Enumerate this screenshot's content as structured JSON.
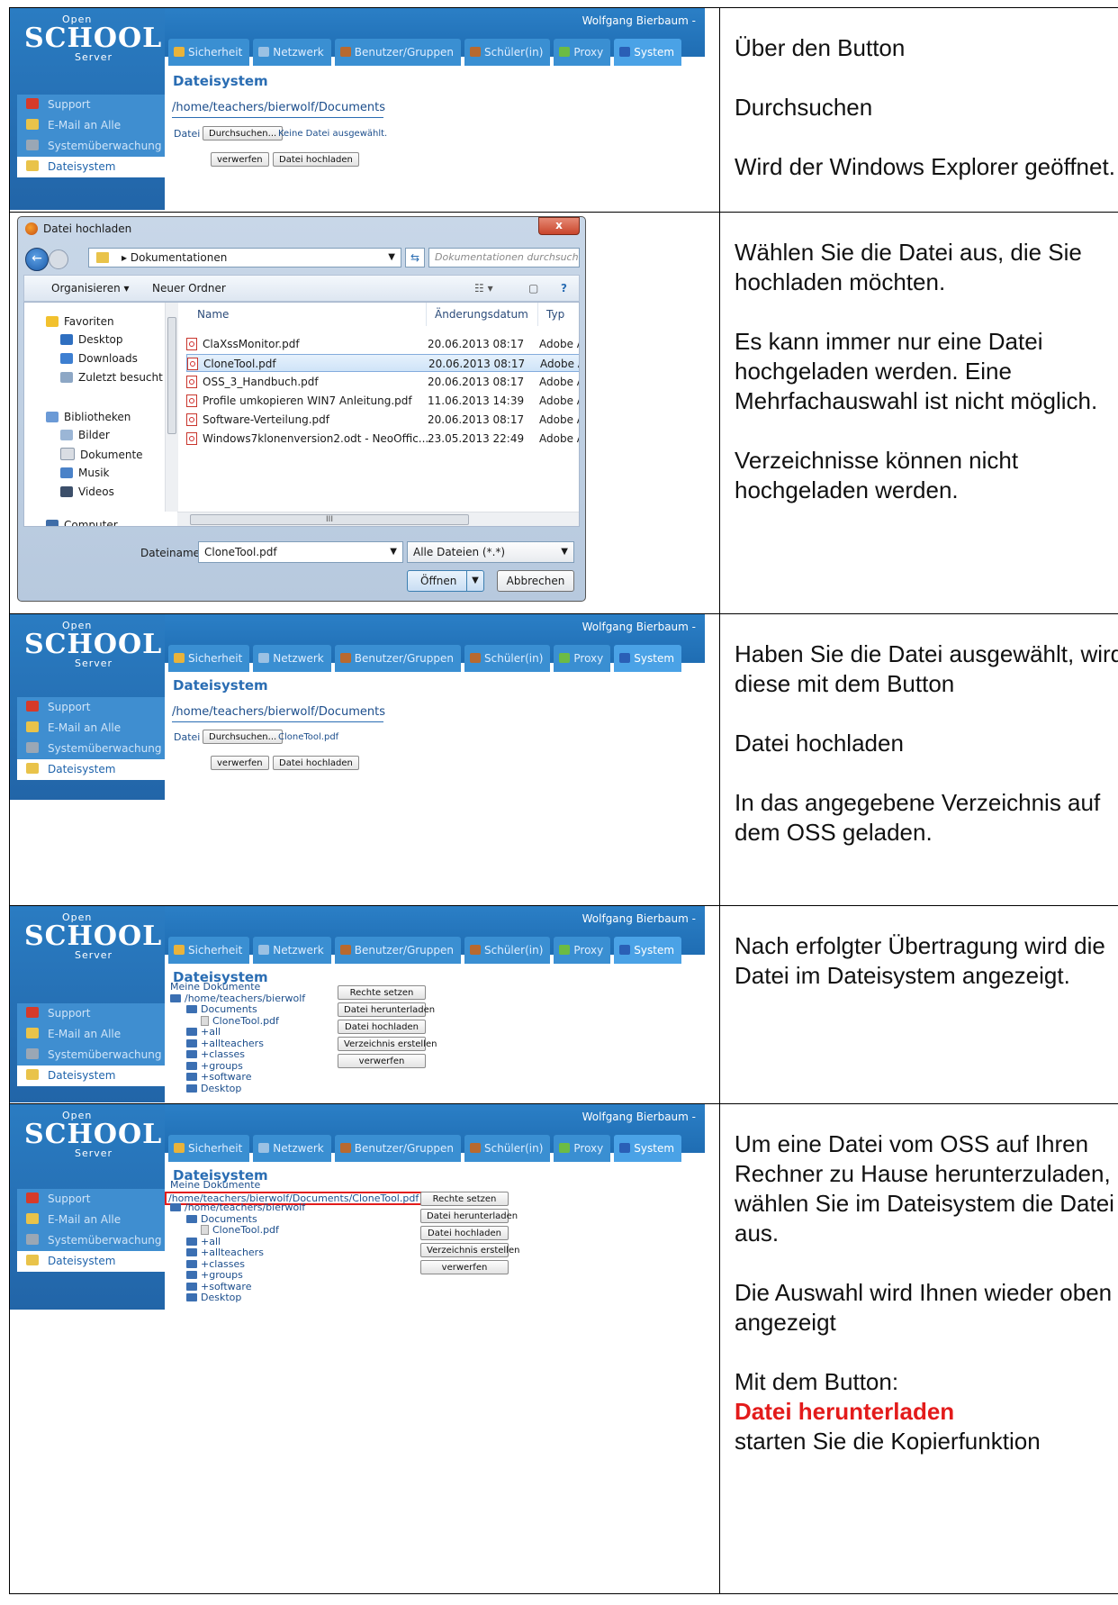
{
  "oss": {
    "logo_open": "Open",
    "logo_school": "SCHOOL",
    "logo_server": "Server",
    "user": "Wolfgang Bierbaum -",
    "tabs": [
      "Sicherheit",
      "Netzwerk",
      "Benutzer/Gruppen",
      "Schüler(in)",
      "Proxy",
      "System"
    ],
    "nav": [
      "Support",
      "E-Mail an Alle",
      "Systemüberwachung",
      "Dateisystem"
    ],
    "heading": "Dateisystem",
    "path": "/home/teachers/bierwolf/Documents",
    "datei_label": "Datei",
    "browse_button": "Durchsuchen...",
    "no_file": "Keine Datei ausgewählt.",
    "selected_file": "CloneTool.pdf",
    "discard_button": "verwerfen",
    "upload_button": "Datei hochladen",
    "meine_dokumente": "Meine Dokumente",
    "tree": [
      "/home/teachers/bierwolf",
      "Documents",
      "CloneTool.pdf",
      "+all",
      "+allteachers",
      "+classes",
      "+groups",
      "+software",
      "Desktop"
    ],
    "selected_path": "/home/teachers/bierwolf/Documents/CloneTool.pdf",
    "fs_buttons": [
      "Rechte setzen",
      "Datei herunterladen",
      "Datei hochladen",
      "Verzeichnis erstellen",
      "verwerfen"
    ]
  },
  "dialog": {
    "title": "Datei hochladen",
    "address": "Dokumentationen",
    "search_placeholder": "Dokumentationen durchsuchen",
    "organize": "Organisieren ▾",
    "new_folder": "Neuer Ordner",
    "nav_items": [
      "Favoriten",
      "Desktop",
      "Downloads",
      "Zuletzt besucht",
      "Bibliotheken",
      "Bilder",
      "Dokumente",
      "Musik",
      "Videos",
      "Computer"
    ],
    "columns": [
      "Name",
      "Änderungsdatum",
      "Typ"
    ],
    "files": [
      {
        "name": "ClaXssMonitor.pdf",
        "date": "20.06.2013 08:17",
        "type": "Adobe Ac"
      },
      {
        "name": "CloneTool.pdf",
        "date": "20.06.2013 08:17",
        "type": "Adobe Ac"
      },
      {
        "name": "OSS_3_Handbuch.pdf",
        "date": "20.06.2013 08:17",
        "type": "Adobe Ac"
      },
      {
        "name": "Profile umkopieren WIN7 Anleitung.pdf",
        "date": "11.06.2013 14:39",
        "type": "Adobe Ac"
      },
      {
        "name": "Software-Verteilung.pdf",
        "date": "20.06.2013 08:17",
        "type": "Adobe Ac"
      },
      {
        "name": "Windows7klonenversion2.odt - NeoOffic...",
        "date": "23.05.2013 22:49",
        "type": "Adobe Ac"
      }
    ],
    "filename_label": "Dateiname:",
    "filename_value": "CloneTool.pdf",
    "filter": "Alle Dateien (*.*)",
    "open_button": "Öffnen",
    "cancel_button": "Abbrechen"
  },
  "text": {
    "row1": [
      "Über den Button",
      "Durchsuchen",
      "Wird der Windows Explorer geöffnet."
    ],
    "row2": [
      "Wählen Sie die Datei aus, die Sie hochladen möchten.",
      "Es kann immer nur eine Datei hochgeladen werden. Eine Mehrfachauswahl ist nicht möglich.",
      "Verzeichnisse können nicht hochgeladen werden."
    ],
    "row3": [
      "Haben Sie die Datei ausgewählt, wird diese mit dem Button",
      "Datei hochladen",
      "In das angegebene Verzeichnis auf dem OSS geladen."
    ],
    "row4": [
      "Nach erfolgter Übertragung wird die Datei im Dateisystem angezeigt."
    ],
    "row5": [
      "Um eine Datei vom OSS auf Ihren Rechner zu Hause herunterzuladen, wählen Sie im Dateisystem die Datei aus.",
      "Die Auswahl wird Ihnen wieder oben angezeigt"
    ],
    "row5_last_intro": "Mit dem Button:",
    "row5_last_red": "Datei herunterladen",
    "row5_last_end": "starten Sie die Kopierfunktion"
  }
}
